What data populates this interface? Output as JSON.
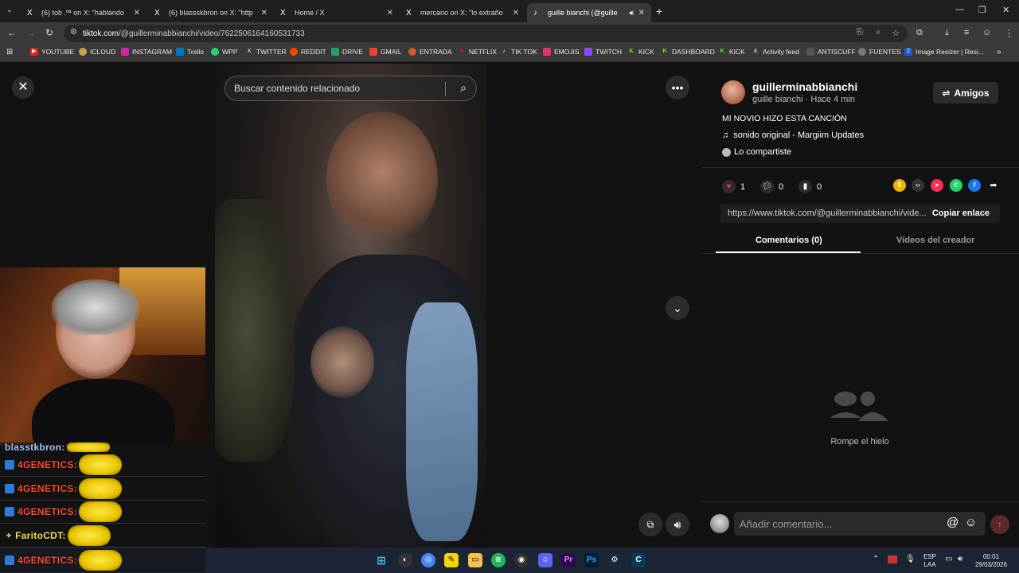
{
  "tabs": [
    {
      "title": "(6) tob .ºª on X: \"hablando de",
      "icon": "X"
    },
    {
      "title": "(6) blassskbron on X: \"https://t",
      "icon": "X"
    },
    {
      "title": "Home / X",
      "icon": "X"
    },
    {
      "title": "mercano on X: \"lo extraño a él",
      "icon": "X"
    },
    {
      "title": "guille bianchi (@guillermina",
      "icon": "♪"
    }
  ],
  "address_bar": {
    "host": "tiktok.com",
    "path": "/@guillerminabbianchi/video/7622506164160531733"
  },
  "bookmarks": [
    "YOUTUBE",
    "ICLOUD",
    "INSTAGRAM",
    "Trello",
    "WPP",
    "TWITTER",
    "REDDIT",
    "DRIVE",
    "GMAIL",
    "ENTRADA",
    "NETFLIX",
    "TIK TOK",
    "EMOJIS",
    "TWITCH",
    "KICK",
    "DASHBOARD",
    "KICK",
    "Activity feed",
    "ANTISCUFF",
    "FUENTES",
    "Image Resizer | Resi..."
  ],
  "search": {
    "placeholder": "Buscar contenido relacionado"
  },
  "creator": {
    "username": "guillerminabbianchi",
    "display": "guille bianchi · Hace 4 min",
    "follow_label": "Amigos"
  },
  "post": {
    "caption": "MI NOVIO HIZO ESTA CANCIÓN",
    "music": "sonido original - Margiim Updates",
    "shared": "Lo compartiste"
  },
  "stats": {
    "likes": "1",
    "comments": "0",
    "saves": "0"
  },
  "link": {
    "url": "https://www.tiktok.com/@guillerminabbianchi/vide...",
    "copy_label": "Copiar enlace"
  },
  "panel_tabs": {
    "comments": "Comentarios (0)",
    "creator_videos": "Vídeos del creador"
  },
  "empty_state": "Rompe el hielo",
  "comment_input": {
    "placeholder": "Añadir comentario..."
  },
  "chat": [
    {
      "user": "blasstkbron:",
      "color": "blue"
    },
    {
      "user": "4GENETICS:",
      "color": "red"
    },
    {
      "user": "4GENETICS:",
      "color": "red"
    },
    {
      "user": "4GENETICS:",
      "color": "red"
    },
    {
      "user": "FaritoCDT:",
      "color": "yellow"
    },
    {
      "user": "4GENETICS:",
      "color": "red"
    }
  ],
  "taskbar": {
    "lang": "ESP",
    "lang2": "LAA",
    "time": "00:01",
    "date": "29/03/2026"
  },
  "colors": {
    "like": "#fe2c55",
    "accent": "#fe2c55"
  }
}
